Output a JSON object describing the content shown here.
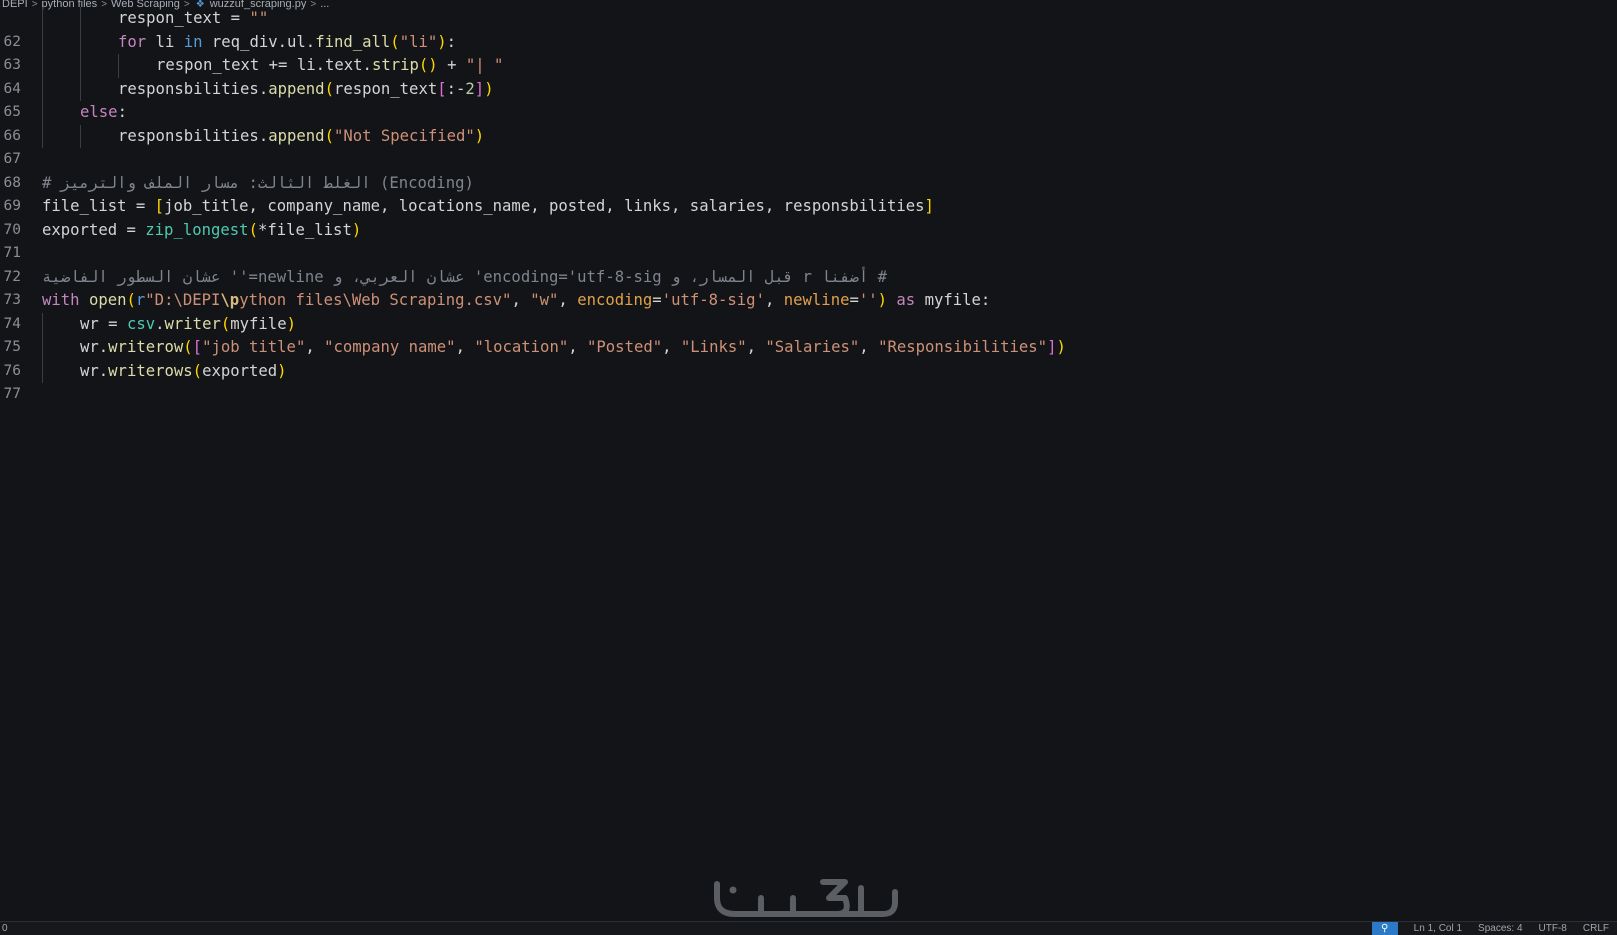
{
  "breadcrumb": {
    "items": [
      "DEPI",
      "python files",
      "Web Scraping",
      "wuzzuf_scraping.py",
      "..."
    ],
    "separator": ">"
  },
  "editor": {
    "lines": [
      {
        "n": "62",
        "code": "respon_text = \"\""
      },
      {
        "n": "63",
        "code": "for li in req_div.ul.find_all(\"li\"):"
      },
      {
        "n": "64",
        "code": "respon_text += li.text.strip() + \"| \""
      },
      {
        "n": "65",
        "code": "responsbilities.append(respon_text[:-2])"
      },
      {
        "n": "66",
        "code": "else:"
      },
      {
        "n": "67",
        "code": "responsbilities.append(\"Not Specified\")"
      },
      {
        "n": "68",
        "code": ""
      },
      {
        "n": "69",
        "code": "# الغلط الثالث: مسار الملف والترميز (Encoding)"
      },
      {
        "n": "70",
        "code": "file_list = [job_title, company_name, locations_name, posted, links, salaries, responsbilities]"
      },
      {
        "n": "71",
        "code": "exported = zip_longest(*file_list)"
      },
      {
        "n": "72",
        "code": ""
      },
      {
        "n": "73",
        "code": "# أضفنا r قبل المسار، و encoding='utf-8-sig' عشان العربي، و newline='' عشان السطور الفاضية"
      },
      {
        "n": "74",
        "code": "with open(r\"D:\\DEPI\\python files\\Web Scraping.csv\", \"w\", encoding='utf-8-sig', newline='') as myfile:"
      },
      {
        "n": "75",
        "code": "wr = csv.writer(myfile)"
      },
      {
        "n": "76",
        "code": "wr.writerow([\"job title\", \"company name\", \"location\", \"Posted\", \"Links\", \"Salaries\", \"Responsibilities\"])"
      },
      {
        "n": "77",
        "code": "wr.writerows(exported)"
      }
    ],
    "tokens": {
      "respon_text": "respon_text",
      "eq": " = ",
      "empty_str": "\"\"",
      "for": "for",
      "li": " li ",
      "in": "in",
      "req_div": " req_div.ul.",
      "find_all": "find_all",
      "li_str": "\"li\"",
      "colon": ":",
      "plus_eq": " += ",
      "li_text": "li.text.",
      "strip": "strip",
      "plus": " + ",
      "pipe_str": "\"| \"",
      "responsbilities": "responsbilities.",
      "append": "append",
      "slice_open": "[",
      "colon_neg": ":-",
      "two": "2",
      "slice_close": "]",
      "else": "else",
      "not_specified": "\"Not Specified\"",
      "comment69_hash": "# ",
      "comment69_ar": "الغلط الثالث: مسار الملف والترميز",
      "comment69_en": " (Encoding)",
      "file_list": "file_list",
      "list_items": "job_title, company_name, locations_name, posted, links, salaries, responsbilities",
      "exported": "exported",
      "zip_longest": "zip_longest",
      "star_file_list": "*file_list",
      "comment73": "# أضفنا r قبل المسار، و encoding='utf-8-sig' عشان العربي، و newline='' عشان السطور الفاضية",
      "with": "with",
      "open": "open",
      "r_prefix": "r",
      "path_a": "\"D:\\DEPI",
      "path_esc": "\\p",
      "path_b": "ython files\\Web Scraping.csv\"",
      "comma_sp": ", ",
      "w_str": "\"w\"",
      "encoding": "encoding",
      "eq_nospace": "=",
      "utf8": "'utf-8-sig'",
      "newline": "newline",
      "empty_single": "''",
      "as": "as",
      "myfile": " myfile:",
      "wr": "wr",
      "csv": "csv",
      "dot": ".",
      "writer": "writer",
      "myfile_arg": "myfile",
      "writerow": "writerow",
      "writerows": "writerows",
      "h1": "\"job title\"",
      "h2": "\"company name\"",
      "h3": "\"location\"",
      "h4": "\"Posted\"",
      "h5": "\"Links\"",
      "h6": "\"Salaries\"",
      "h7": "\"Responsibilities\"",
      "exported_arg": "exported"
    }
  },
  "statusbar": {
    "left": "0",
    "zoom_icon": "zoom-icon",
    "position": "Ln 1, Col 1",
    "spaces": "Spaces: 4",
    "encoding": "UTF-8",
    "eol": "CRLF"
  },
  "watermark": {
    "text": "خمسات"
  },
  "colors": {
    "background": "#121417",
    "keyword": "#c586c0",
    "function": "#dcdcaa",
    "string": "#ce9178",
    "comment": "#7f848e",
    "bracket_gold": "#ffd700",
    "bracket_purple": "#da70d6",
    "bracket_blue": "#179fff",
    "status_accent": "#2a7ac7"
  }
}
